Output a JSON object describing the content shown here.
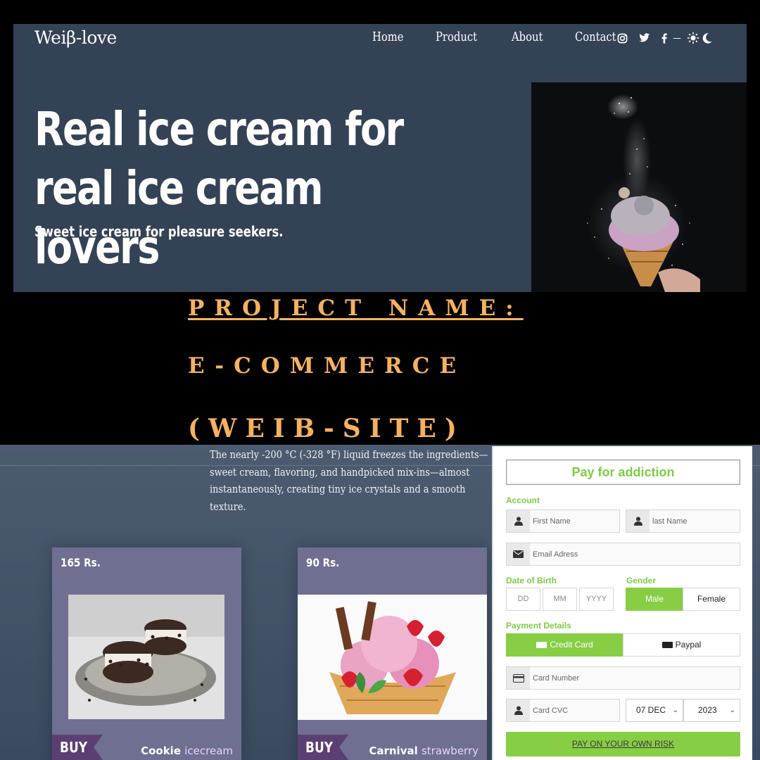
{
  "hero": {
    "brand": "Weiβ-love",
    "nav": [
      "Home",
      "Product",
      "About",
      "Contact"
    ],
    "socials": [
      "instagram-icon",
      "twitter-icon",
      "facebook-icon"
    ],
    "theme_separator": "—",
    "title": "Real ice cream for real ice cream lovers",
    "subtitle": "Sweet ice cream for pleasure seekers."
  },
  "project": {
    "line1": "PROJECT NAME:",
    "line2": "E-COMMERCE",
    "line3": "(WEIB-SITE)"
  },
  "store": {
    "description": "The nearly -200 °C (-328 °F) liquid freezes the ingredients—sweet cream, flavoring, and handpicked mix-ins—almost instantaneously, creating tiny ice crystals and a smooth texture.",
    "products": [
      {
        "price": "165 Rs.",
        "buy": "BUY",
        "name": "Cookie",
        "variant": "icecream"
      },
      {
        "price": "90 Rs.",
        "buy": "BUY",
        "name": "Carnival",
        "variant": "strawberry"
      }
    ]
  },
  "payment": {
    "title": "Pay for addiction",
    "account_label": "Account",
    "first_name_placeholder": "First Name",
    "last_name_placeholder": "last Name",
    "email_placeholder": "Email Adress",
    "dob_label": "Date of Birth",
    "dob_fields": [
      "DD",
      "MM",
      "YYYY"
    ],
    "gender_label": "Gender",
    "gender_options": [
      "Male",
      "Female"
    ],
    "gender_selected": "Male",
    "payment_label": "Payment Details",
    "payment_methods": [
      "Credit Card",
      "Paypal"
    ],
    "payment_selected": "Credit Card",
    "card_number_placeholder": "Card Number",
    "card_cvc_placeholder": "Card CVC",
    "expiry_month": "07 DEC",
    "expiry_year": "2023",
    "submit": "PAY ON YOUR OWN RISK"
  },
  "colors": {
    "hero_bg": "#344255",
    "accent_green": "#87ce45",
    "project_title": "#f5b25e",
    "card_bg": "#6e6f91",
    "buy_tag": "#5b3f73"
  }
}
